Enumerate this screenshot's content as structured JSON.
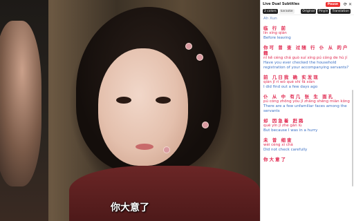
{
  "video": {
    "subtitle": "你大意了"
  },
  "panel": {
    "title": "Live Dual Subtitles",
    "pause_label": "Pause",
    "toolbar": {
      "colors_label": "2 colors",
      "karaoke_label": "karaoke",
      "original_label": "Original",
      "pinyin_label": "Pinyin",
      "translation_label": "Translation"
    },
    "entries": [
      {
        "zh": "",
        "py": "",
        "en": "Ah Xun"
      },
      {
        "zh": "临 行 前",
        "py": "lín xíng qián",
        "en": "Before leaving"
      },
      {
        "zh": "你可 曾 查 过随 行 仆 从 的户籍",
        "py": "nǐ kě céng chá guò suí xíng pú cóng de hù jí",
        "en": "Have you ever checked the household registration of your accompanying servants?"
      },
      {
        "zh": "前 几日我 确 实发现",
        "py": "qián jǐ rì wǒ què shí fā xiàn",
        "en": "I did find out a few days ago"
      },
      {
        "zh": "仆 从 中 有几 张 生 面孔",
        "py": "pú cóng zhōng yǒu jǐ zhāng shēng miàn kǒng",
        "en": "There are a few unfamiliar faces among the servants"
      },
      {
        "zh": "却 因急着 赶路",
        "py": "què yīn jí zhe gǎn lù",
        "en": "But because I was in a hurry"
      },
      {
        "zh": "未 曾 细查",
        "py": "wèi céng xì chá",
        "en": "Did not check carefully"
      },
      {
        "zh": "你大意了",
        "py": "",
        "en": ""
      }
    ]
  }
}
